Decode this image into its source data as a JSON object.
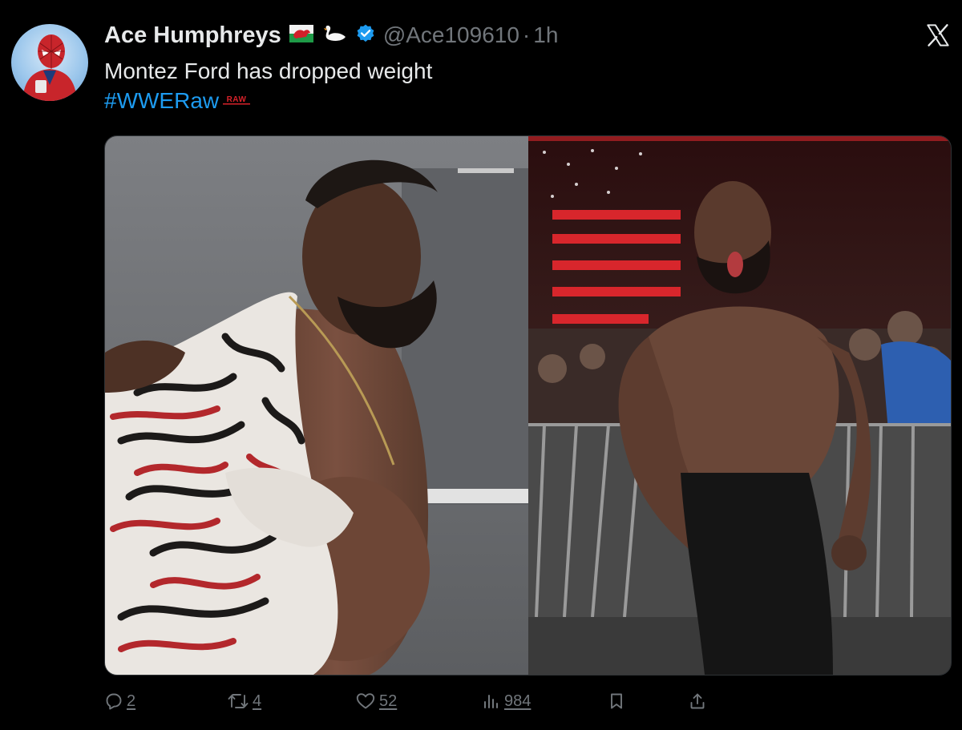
{
  "author": {
    "display_name": "Ace Humphreys",
    "handle": "@Ace109610",
    "time_separator": "·",
    "timestamp": "1h",
    "badges": [
      "wales-flag-icon",
      "swan-icon",
      "verified-badge-icon"
    ]
  },
  "platform_logo": "x-logo-icon",
  "tweet": {
    "text": "Montez Ford has dropped weight",
    "hashtag": "#WWERaw",
    "hashtag_emoji": "RAW"
  },
  "media": {
    "panels": [
      "before-photo",
      "after-photo"
    ]
  },
  "actions": {
    "replies": "2",
    "reposts": "4",
    "likes": "52",
    "views": "984"
  },
  "colors": {
    "background": "#000000",
    "text": "#e7e9ea",
    "secondary": "#71767b",
    "accent": "#1d9bf0"
  }
}
